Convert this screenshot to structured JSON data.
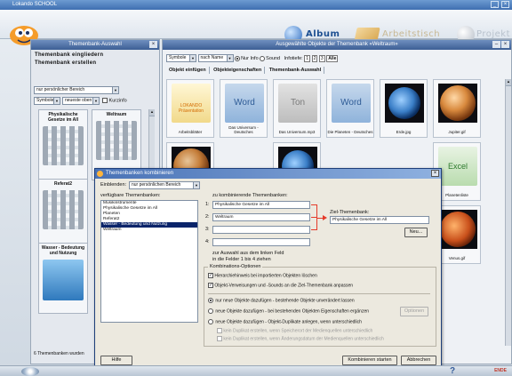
{
  "app": {
    "title": "Lokando SCHOOL"
  },
  "topnav": {
    "album": "Album",
    "arbeitstisch": "Arbeitstisch",
    "projekt": "Projekt"
  },
  "left_panel": {
    "title": "Themenbank-Auswahl",
    "link_import": "Themenbank eingliedern",
    "link_create": "Themenbank erstellen",
    "scope": "nur persönlicher Bereich",
    "sort_view": "Symbole",
    "sort_order": "neueste oben",
    "kurzinfo": "Kurzinfo",
    "banks": [
      {
        "name": "Physikalische Gesetze im All"
      },
      {
        "name": "Weltraum"
      },
      {
        "name": "Referat2"
      },
      {
        "name": "Wasser - Bedeutung und Nutzung"
      }
    ],
    "count": "6 Themenbanken wurden"
  },
  "right_panel": {
    "title": "Ausgewählte Objekte der Themenbank «Weltraum»",
    "view": "Symbole",
    "sort": "nach Name",
    "filter_label_all": "Alle",
    "filter_text": "Nur Info",
    "filter_sound": "Sound",
    "infotiefe_label": "Infotiefe:",
    "infotiefe_values": [
      "1",
      "2",
      "3"
    ],
    "alle": "Alle",
    "tabs": [
      "Objekt einfügen",
      "Objekteigenschaften",
      "Themenbank-Auswahl"
    ],
    "thumbs": [
      {
        "label": "Arbeitsblätter",
        "kind": "presentation",
        "text": "LOKANDO Präsentation"
      },
      {
        "label": "Das Universum - Deutsches",
        "kind": "word",
        "text": "Word"
      },
      {
        "label": "Das Universum.mp3",
        "kind": "sound",
        "text": "Ton"
      },
      {
        "label": "Die Planeten - Deutsches",
        "kind": "word",
        "text": "Word"
      },
      {
        "label": "Erde.jpg",
        "kind": "earth",
        "text": ""
      },
      {
        "label": "Jupiter.gif",
        "kind": "jupiter",
        "text": ""
      },
      {
        "label": "Planetenliste",
        "kind": "excel",
        "text": "Excel"
      },
      {
        "label": "Venus.gif",
        "kind": "mars",
        "text": ""
      }
    ]
  },
  "dialog": {
    "title": "Themenbanken kombinieren",
    "einblenden_label": "Einblenden:",
    "einblenden_value": "nur persönlichen Bereich",
    "source_label": "verfügbare Themenbanken:",
    "source_items": [
      {
        "text": "Musikinstrumente",
        "selected": false
      },
      {
        "text": "Physikalische Gesetze im All",
        "selected": false
      },
      {
        "text": "Planeten",
        "selected": false
      },
      {
        "text": "Referat2",
        "selected": false
      },
      {
        "text": "Wasser - Bedeutung und Nutzung",
        "selected": true
      },
      {
        "text": "Weltraum",
        "selected": false
      }
    ],
    "combine_label": "zu kombinierende Themenbanken:",
    "slots": [
      {
        "num": "1:",
        "value": "Physikalische Gesetze im All"
      },
      {
        "num": "2:",
        "value": "Weltraum"
      },
      {
        "num": "3:",
        "value": ""
      },
      {
        "num": "4:",
        "value": ""
      }
    ],
    "target_label": "Ziel-Themenbank:",
    "target_value": "Physikalische Gesetze im All",
    "new_button": "Neu...",
    "hint_line1": "zur Auswahl aus dem linken Feld",
    "hint_line2": "in die Felder 1 bis 4 ziehen",
    "options_label": "Kombinations-Optionen",
    "opt_hierarchy": "Hierarchiehinweis bei importierten Objekten löschen",
    "opt_links": "Objekt-Verweisungen und -Sounds an die Ziel-Themenbank anpassen",
    "radio1": "nur neue Objekte dazufügen - bestehende Objekte unverändert lassen",
    "radio2": "neue Objekte dazufügen - bei bestehenden Objekten Eigenschaften ergänzen",
    "options_btn": "Optionen",
    "radio3": "neue Objekte dazufügen - Objekt-Duplikate anlegen, wenn unterschiedlich",
    "sub1": "kein Duplikat erstellen, wenn Speicherort der Medienquellen unterschiedlich",
    "sub2": "kein Duplikat erstellen, wenn Änderungsdatum der Medienquellen unterschiedlich",
    "help_btn": "Hilfe",
    "start_btn": "Kombinieren starten",
    "cancel_btn": "Abbrechen"
  },
  "status": {
    "help_glyph": "?",
    "end": "ENDE"
  }
}
